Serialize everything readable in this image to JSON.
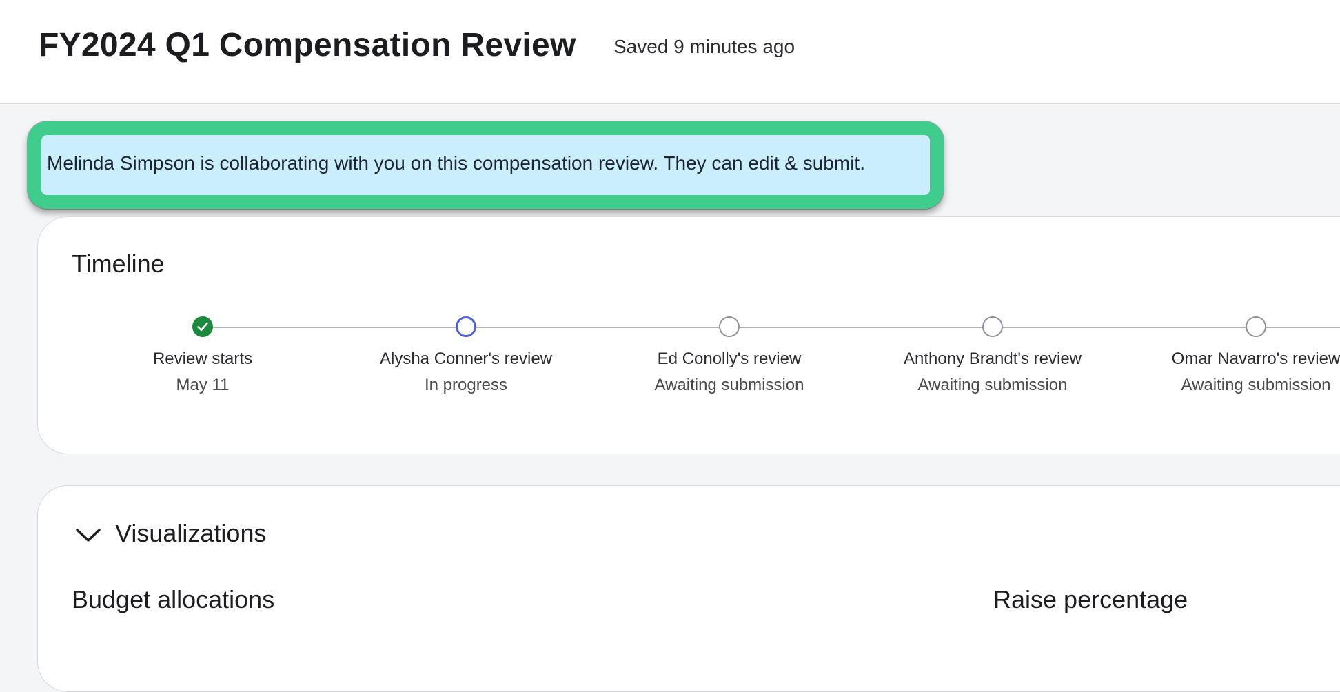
{
  "header": {
    "title": "FY2024 Q1 Compensation Review",
    "save_status": "Saved 9 minutes ago"
  },
  "banner": {
    "text": "Melinda Simpson is collaborating with you on this compensation review. They can edit & submit.",
    "highlight_color": "#3fcc8c",
    "background_color": "#cbeefc"
  },
  "timeline": {
    "title": "Timeline",
    "steps": [
      {
        "label": "Review starts",
        "status": "May 11",
        "state": "complete",
        "icon": "check-icon"
      },
      {
        "label": "Alysha Conner's review",
        "status": "In progress",
        "state": "active",
        "icon": "circle-icon"
      },
      {
        "label": "Ed Conolly's review",
        "status": "Awaiting submission",
        "state": "pending",
        "icon": "circle-icon"
      },
      {
        "label": "Anthony Brandt's review",
        "status": "Awaiting submission",
        "state": "pending",
        "icon": "circle-icon"
      },
      {
        "label": "Omar Navarro's review",
        "status": "Awaiting submission",
        "state": "pending",
        "icon": "circle-icon"
      }
    ],
    "colors": {
      "complete": "#1c8a3c",
      "active": "#4e62e0",
      "pending": "#8d9199"
    }
  },
  "visualizations": {
    "title": "Visualizations",
    "toggle_icon": "chevron-down-icon",
    "sections": [
      {
        "title": "Budget allocations"
      },
      {
        "title": "Raise percentage"
      }
    ]
  }
}
